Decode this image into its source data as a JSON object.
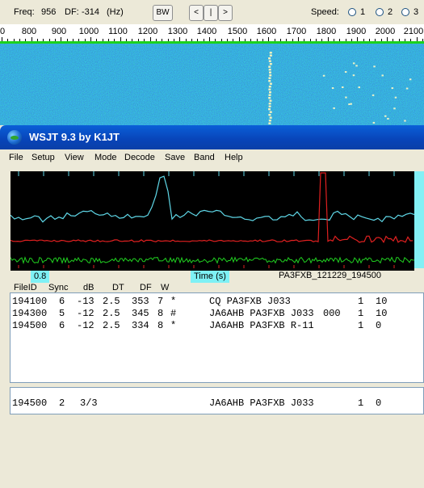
{
  "spec_toolbar": {
    "freq_label": "Freq:",
    "freq_value": "956",
    "df_label": "DF:",
    "df_value": "-314",
    "df_unit": "(Hz)",
    "bw_button": "BW",
    "nav_left": "<",
    "nav_mid": "|",
    "nav_right": ">",
    "speed_label": "Speed:",
    "speed_options": [
      "1",
      "2",
      "3"
    ]
  },
  "freq_ruler": {
    "ticks": [
      "0",
      "800",
      "900",
      "1000",
      "1100",
      "1200",
      "1300",
      "1400",
      "1500",
      "1600",
      "1700",
      "1800",
      "1900",
      "2000",
      "2100"
    ]
  },
  "window": {
    "title": "WSJT 9.3     by K1JT"
  },
  "menu": [
    "File",
    "Setup",
    "View",
    "Mode",
    "Decode",
    "Save",
    "Band",
    "Help"
  ],
  "plot": {
    "sync_value": "0.8",
    "time_label": "Time (s)",
    "filename": "PA3FXB_121229_194500",
    "colors": {
      "cyan": "#5fd8e8",
      "red": "#e02020",
      "green": "#20d020"
    }
  },
  "decode_headers": [
    "FileID",
    "Sync",
    "dB",
    "DT",
    "DF",
    "W"
  ],
  "decodes": [
    {
      "file": "194100",
      "sync": "6",
      "db": "-13",
      "dt": "2.5",
      "df": "353",
      "w": "7",
      "flag": "*",
      "msg": "CQ PA3FXB J033",
      "extra": "",
      "n1": "1",
      "n2": "10"
    },
    {
      "file": "194300",
      "sync": "5",
      "db": "-12",
      "dt": "2.5",
      "df": "345",
      "w": "8",
      "flag": "#",
      "msg": "JA6AHB PA3FXB J033",
      "extra": "000",
      "n1": "1",
      "n2": "10"
    },
    {
      "file": "194500",
      "sync": "6",
      "db": "-12",
      "dt": "2.5",
      "df": "334",
      "w": "8",
      "flag": "*",
      "msg": "JA6AHB PA3FXB R-11",
      "extra": "",
      "n1": "1",
      "n2": "0"
    }
  ],
  "average": {
    "file": "194500",
    "sync": "2",
    "count": "3/3",
    "msg": "JA6AHB PA3FXB J033",
    "n1": "1",
    "n2": "0"
  }
}
